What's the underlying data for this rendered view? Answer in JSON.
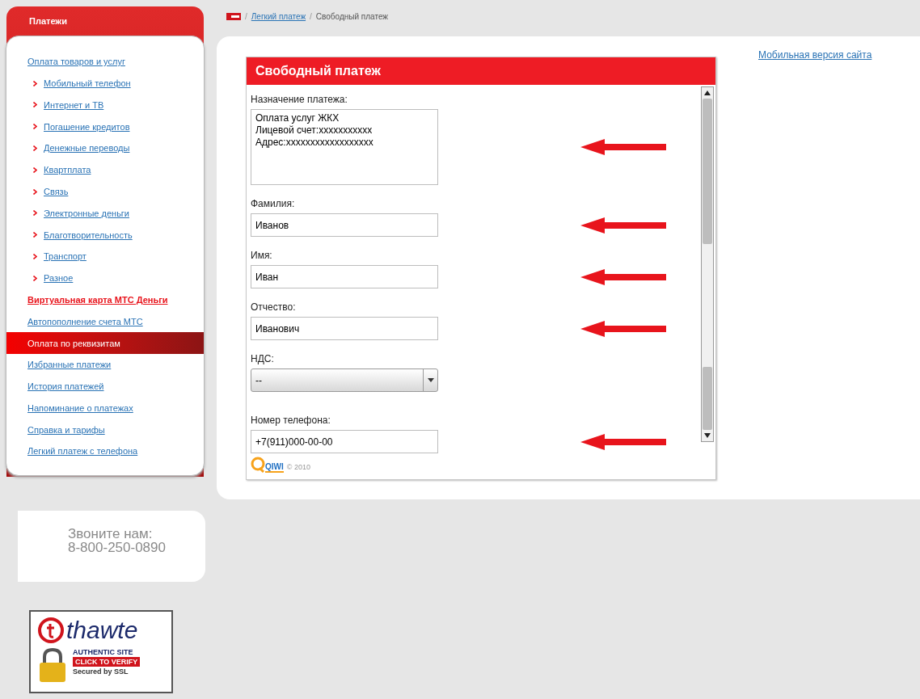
{
  "sidebar": {
    "title": "Платежи",
    "items": [
      {
        "label": "Оплата товаров и услуг",
        "kind": "link",
        "selected": false
      },
      {
        "label": "Мобильный телефон",
        "kind": "sub",
        "selected": false
      },
      {
        "label": "Интернет и ТВ",
        "kind": "sub",
        "selected": false
      },
      {
        "label": "Погашение кредитов",
        "kind": "sub",
        "selected": false
      },
      {
        "label": "Денежные переводы",
        "kind": "sub",
        "selected": false
      },
      {
        "label": "Квартплата",
        "kind": "sub",
        "selected": false
      },
      {
        "label": "Связь",
        "kind": "sub",
        "selected": false
      },
      {
        "label": "Электронные деньги",
        "kind": "sub",
        "selected": false
      },
      {
        "label": "Благотворительность",
        "kind": "sub",
        "selected": false
      },
      {
        "label": "Транспорт",
        "kind": "sub",
        "selected": false
      },
      {
        "label": "Разное",
        "kind": "sub",
        "selected": false
      },
      {
        "label": "Виртуальная карта МТС Деньги",
        "kind": "promo",
        "selected": false
      },
      {
        "label": "Автопополнение счета МТС",
        "kind": "link",
        "selected": false
      },
      {
        "label": "Оплата по реквизитам",
        "kind": "link",
        "selected": true
      },
      {
        "label": "Избранные платежи",
        "kind": "link",
        "selected": false
      },
      {
        "label": "История платежей",
        "kind": "link",
        "selected": false
      },
      {
        "label": "Напоминание о платежах",
        "kind": "link",
        "selected": false
      },
      {
        "label": "Справка и тарифы",
        "kind": "link",
        "selected": false
      },
      {
        "label": "Легкий платеж с телефона",
        "kind": "link",
        "selected": false
      }
    ]
  },
  "call": {
    "label": "Звоните нам:",
    "phone": "8-800-250-0890"
  },
  "badge": {
    "brand": "thawte",
    "line_1": "AUTHENTIC SITE",
    "line_2": "CLICK TO VERIFY",
    "line_3": "Secured by SSL"
  },
  "breadcrumb": {
    "separator": "/",
    "link": "Легкий платеж",
    "current": "Свободный платеж"
  },
  "mobile_link": "Мобильная версия сайта",
  "form": {
    "title": "Свободный платеж",
    "fields": [
      {
        "label": "Назначение платежа:",
        "kind": "textarea",
        "value": "Оплата услуг ЖКХ\nЛицевой счет:xxxxxxxxxxx\nАдрес:xxxxxxxxxxxxxxxxxx",
        "arrow": true
      },
      {
        "label": "Фамилия:",
        "kind": "text",
        "value": "Иванов",
        "arrow": true
      },
      {
        "label": "Имя:",
        "kind": "text",
        "value": "Иван",
        "arrow": true
      },
      {
        "label": "Отчество:",
        "kind": "text",
        "value": "Иванович",
        "arrow": true
      },
      {
        "label": "НДС:",
        "kind": "select",
        "value": "--",
        "arrow": false
      },
      {
        "label": "Номер телефона:",
        "kind": "text",
        "value": "+7(911)000-00-00",
        "arrow": true
      }
    ],
    "logo": "QIWI",
    "copyright": "© 2010"
  }
}
